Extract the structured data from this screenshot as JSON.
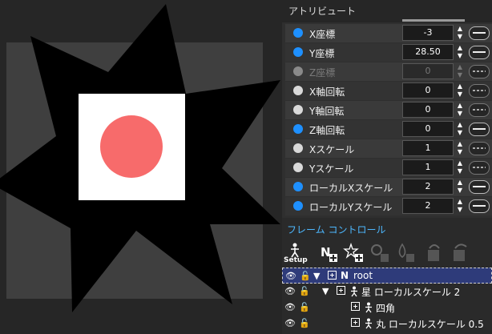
{
  "attributes_panel": {
    "title": "アトリビュート",
    "rows": [
      {
        "label": "X座標",
        "value": "-3",
        "state": "on"
      },
      {
        "label": "Y座標",
        "value": "28.50",
        "state": "on"
      },
      {
        "label": "Z座標",
        "value": "0",
        "state": "disabled"
      },
      {
        "label": "X軸回転",
        "value": "0",
        "state": "off"
      },
      {
        "label": "Y軸回転",
        "value": "0",
        "state": "off"
      },
      {
        "label": "Z軸回転",
        "value": "0",
        "state": "on"
      },
      {
        "label": "Xスケール",
        "value": "1",
        "state": "off"
      },
      {
        "label": "Yスケール",
        "value": "1",
        "state": "off"
      },
      {
        "label": "ローカルXスケール",
        "value": "2",
        "state": "on"
      },
      {
        "label": "ローカルYスケール",
        "value": "2",
        "state": "on"
      }
    ]
  },
  "frame_control": {
    "title": "フレーム コントロール",
    "setup_label": "Setup",
    "new_node_glyph": "N",
    "tree": [
      {
        "label": "root",
        "glyph": "N",
        "depth": 0,
        "selected": true
      },
      {
        "label": "星 ローカルスケール 2",
        "glyph": "figure",
        "depth": 1,
        "selected": false
      },
      {
        "label": "四角",
        "glyph": "figure",
        "depth": 2,
        "selected": false
      },
      {
        "label": "丸 ローカルスケール 0.5",
        "glyph": "figure",
        "depth": 2,
        "selected": false
      }
    ]
  },
  "colors": {
    "accent_blue": "#1e90ff",
    "title_blue": "#4db8ff",
    "circle": "#f76b6b",
    "selection": "#2e3b7a"
  }
}
